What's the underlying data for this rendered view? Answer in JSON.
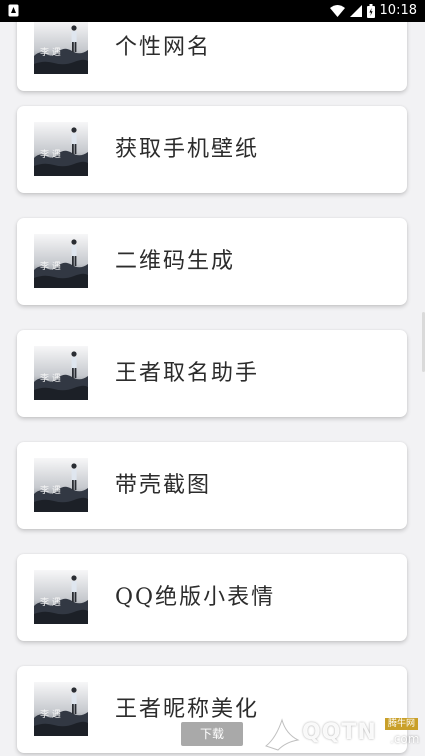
{
  "status_bar": {
    "time": "10:18",
    "icons": [
      "notification-icon",
      "wifi-icon",
      "signal-icon",
      "battery-icon"
    ]
  },
  "menu_items": [
    {
      "label": "个性网名"
    },
    {
      "label": "获取手机壁纸"
    },
    {
      "label": "二维码生成"
    },
    {
      "label": "王者取名助手"
    },
    {
      "label": "带壳截图"
    },
    {
      "label": "QQ绝版小表情"
    },
    {
      "label": "王者昵称美化"
    }
  ],
  "download_button": {
    "label": "下载"
  },
  "watermark": {
    "tag": "腾牛网",
    "text": "QQTN",
    "domain": ".com"
  },
  "colors": {
    "background": "#f2f2f4",
    "card": "#ffffff",
    "text": "#2c2c2c",
    "status_bar": "#000000"
  }
}
